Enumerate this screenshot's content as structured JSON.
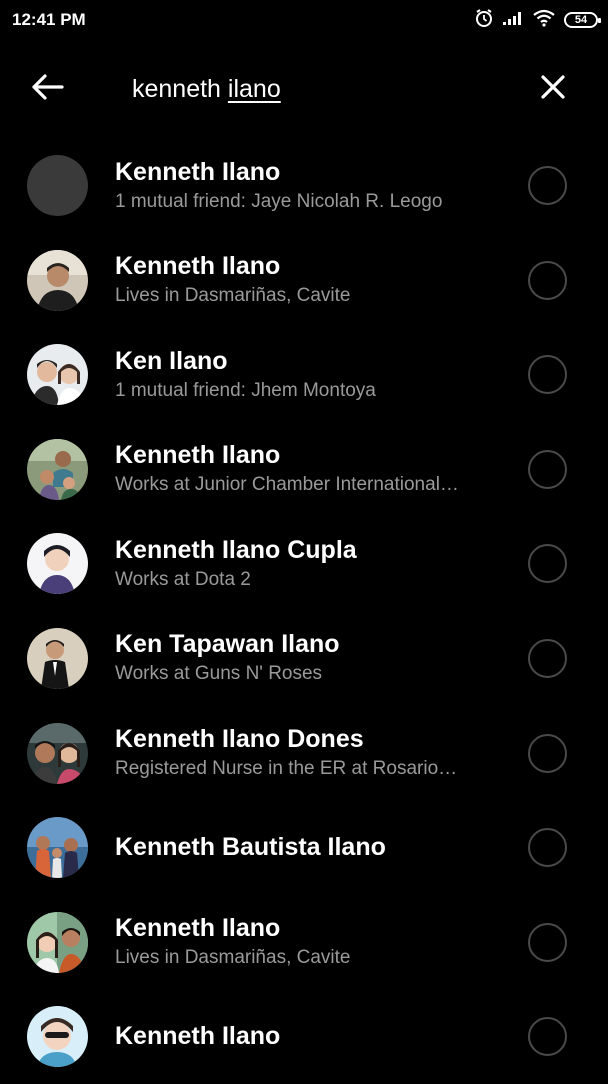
{
  "status_bar": {
    "time": "12:41 PM",
    "battery_level": "54",
    "icons": [
      "alarm-icon",
      "signal-icon",
      "wifi-icon",
      "battery-icon"
    ]
  },
  "search": {
    "query_plain": "kenneth ",
    "query_underlined": "ilano",
    "value": "kenneth ilano",
    "back_icon": "arrow-left-icon",
    "clear_icon": "close-icon"
  },
  "results": [
    {
      "name": "Kenneth Ilano",
      "detail": "1 mutual friend: Jaye Nicolah R. Leogo",
      "selected": false
    },
    {
      "name": "Kenneth Ilano",
      "detail": "Lives in Dasmariñas, Cavite",
      "selected": false
    },
    {
      "name": "Ken Ilano",
      "detail": "1 mutual friend: Jhem Montoya",
      "selected": false
    },
    {
      "name": "Kenneth Ilano",
      "detail": "Works at Junior Chamber International…",
      "selected": false
    },
    {
      "name": "Kenneth Ilano Cupla",
      "detail": "Works at Dota 2",
      "selected": false
    },
    {
      "name": "Ken Tapawan Ilano",
      "detail": "Works at Guns N' Roses",
      "selected": false
    },
    {
      "name": "Kenneth Ilano Dones",
      "detail": "Registered Nurse in the ER at Rosario…",
      "selected": false
    },
    {
      "name": "Kenneth Bautista Ilano",
      "detail": "",
      "selected": false
    },
    {
      "name": "Kenneth Ilano",
      "detail": "Lives in Dasmariñas, Cavite",
      "selected": false
    },
    {
      "name": "Kenneth Ilano",
      "detail": "",
      "selected": false
    }
  ],
  "colors": {
    "background": "#000000",
    "text_primary": "#ffffff",
    "text_secondary": "#9a9a9a",
    "radio_border": "#4a4a4a"
  }
}
